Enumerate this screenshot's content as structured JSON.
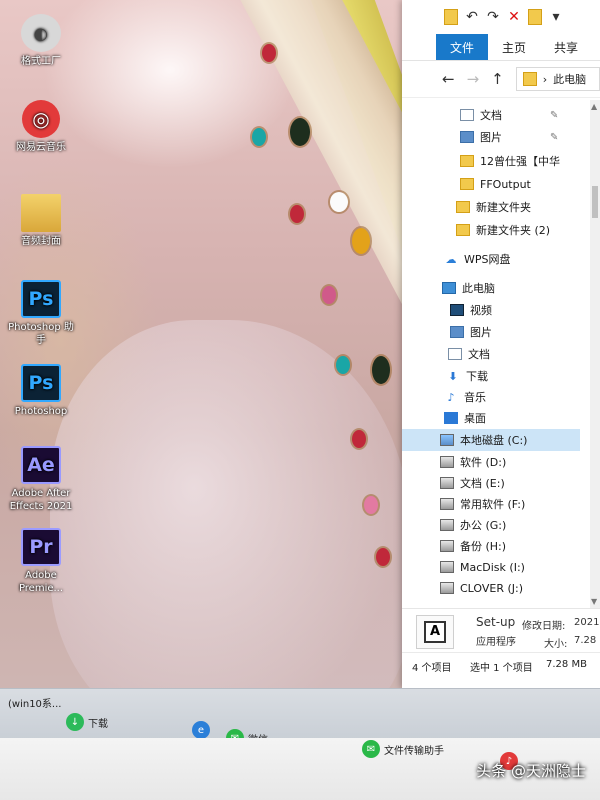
{
  "desktop": {
    "icons": [
      {
        "label": "格式工厂",
        "glyph": "◐"
      },
      {
        "label": "网易云音乐",
        "glyph": "◎"
      },
      {
        "label": "音频封面",
        "glyph": ""
      },
      {
        "label": "Photoshop 助手",
        "glyph": "Ps"
      },
      {
        "label": "Photoshop",
        "glyph": "Ps"
      },
      {
        "label": "Adobe After Effects 2021",
        "glyph": "Ae"
      },
      {
        "label": "Adobe Premie...",
        "glyph": "Pr"
      }
    ]
  },
  "explorer": {
    "qat": {
      "undo": "↶",
      "redo": "↷",
      "delete": "✕",
      "dropdown": "▾"
    },
    "tabs": [
      "文件",
      "主页",
      "共享"
    ],
    "nav": {
      "back": "←",
      "forward": "→",
      "up": "↑",
      "chevron": "›"
    },
    "address": "此电脑",
    "pin_glyph": "✎",
    "quick_access": [
      {
        "label": "文档",
        "type": "doc",
        "pinned": true
      },
      {
        "label": "图片",
        "type": "pic",
        "pinned": true
      },
      {
        "label": "12曾仕强【中华",
        "type": "folder",
        "pinned": false
      },
      {
        "label": "FFOutput",
        "type": "folder",
        "pinned": false
      },
      {
        "label": "新建文件夹",
        "type": "folder",
        "pinned": false
      },
      {
        "label": "新建文件夹 (2)",
        "type": "folder",
        "pinned": false
      }
    ],
    "wps": "WPS网盘",
    "this_pc": "此电脑",
    "pc_items": [
      "视频",
      "图片",
      "文档",
      "下载",
      "音乐",
      "桌面"
    ],
    "drives": [
      "本地磁盘 (C:)",
      "软件 (D:)",
      "文档 (E:)",
      "常用软件 (F:)",
      "办公 (G:)",
      "备份 (H:)",
      "MacDisk (I:)",
      "CLOVER (J:)"
    ],
    "selected_drive_index": 0,
    "details": {
      "name": "Set-up",
      "type": "应用程序",
      "modified_label": "修改日期:",
      "modified_value": "2021",
      "size_label": "大小:",
      "size_value": "7.28",
      "thumb_glyph": "A"
    },
    "status": {
      "count": "4 个项目",
      "selection": "选中 1 个项目",
      "size": "7.28 MB"
    }
  },
  "taskbar": {
    "items": [
      {
        "label": "(win10系...",
        "glyph": ""
      },
      {
        "label": "下载",
        "glyph": "↓"
      },
      {
        "label": "",
        "glyph": "e"
      },
      {
        "label": "微信",
        "glyph": "✉"
      },
      {
        "label": "文件传输助手",
        "glyph": "✉"
      },
      {
        "label": "",
        "glyph": "♪"
      }
    ]
  },
  "watermark": "头条 @天洲隐士"
}
